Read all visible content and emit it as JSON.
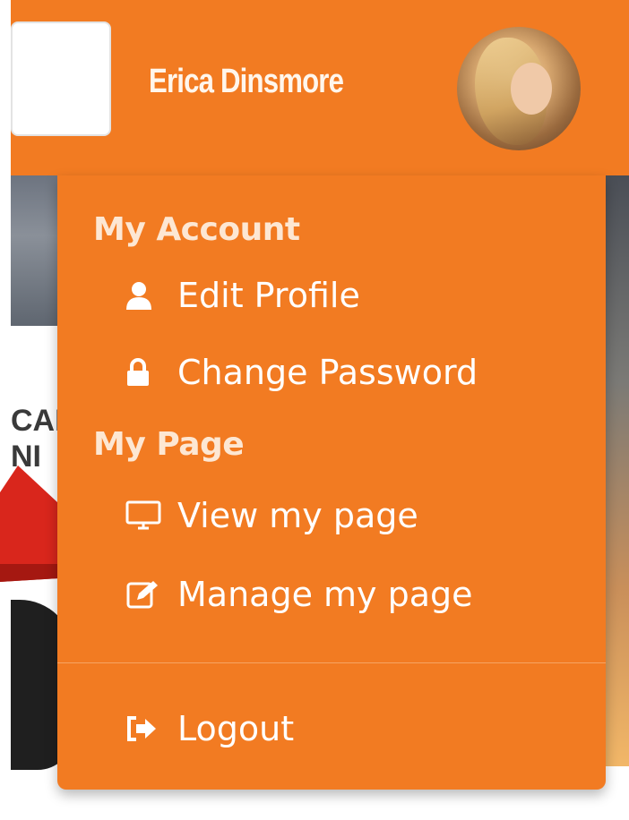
{
  "header": {
    "user_name": "Erica Dinsmore",
    "search": {
      "placeholder": ""
    }
  },
  "background_text": {
    "line1": "CAI",
    "line2": "NI"
  },
  "dropdown": {
    "sections": [
      {
        "title": "My Account",
        "items": [
          {
            "label": "Edit Profile",
            "icon": "user-icon"
          },
          {
            "label": "Change Password",
            "icon": "lock-icon"
          }
        ]
      },
      {
        "title": "My Page",
        "items": [
          {
            "label": "View my page",
            "icon": "monitor-icon"
          },
          {
            "label": "Manage my page",
            "icon": "edit-icon"
          }
        ]
      }
    ],
    "logout": {
      "label": "Logout",
      "icon": "sign-out-icon"
    }
  },
  "colors": {
    "accent": "#f27b22",
    "menu_text": "#ffffff",
    "section_title": "#fde7d3",
    "arrow": "#d9261c"
  }
}
